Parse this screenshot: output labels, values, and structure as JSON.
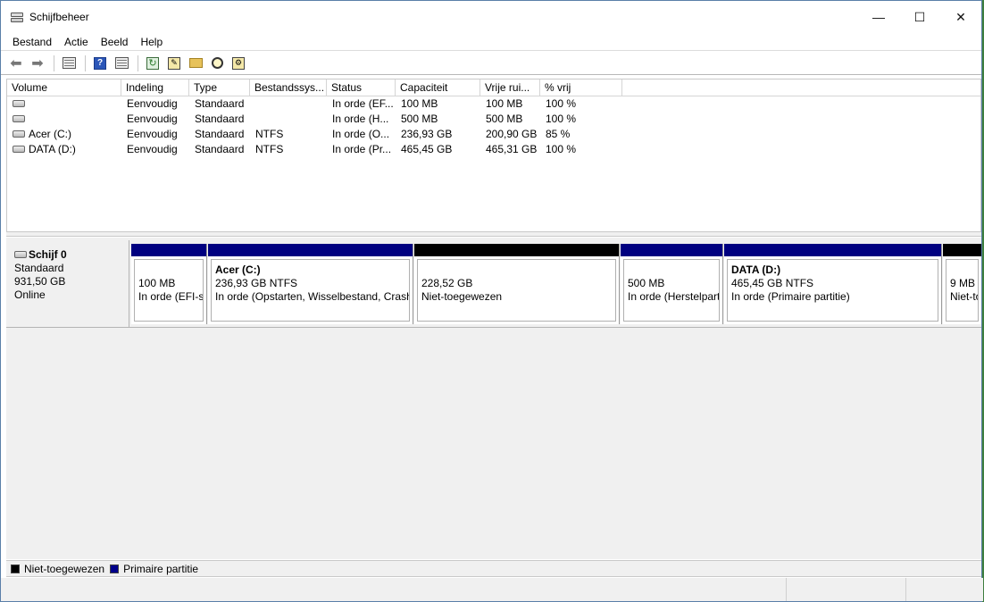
{
  "window": {
    "title": "Schijfbeheer",
    "controls": {
      "minimize": "—",
      "maximize": "☐",
      "close": "✕"
    }
  },
  "menu": [
    "Bestand",
    "Actie",
    "Beeld",
    "Help"
  ],
  "toolbar": {
    "icons": [
      "back-icon",
      "forward-icon",
      "console-tree-icon",
      "help-icon",
      "view-icon",
      "refresh-icon",
      "properties-icon",
      "open-folder-icon",
      "explore-icon",
      "settings-icon"
    ]
  },
  "volume_table": {
    "columns": [
      "Volume",
      "Indeling",
      "Type",
      "Bestandssys...",
      "Status",
      "Capaciteit",
      "Vrije rui...",
      "% vrij"
    ],
    "rows": [
      [
        "",
        "Eenvoudig",
        "Standaard",
        "",
        "In orde (EF...",
        "100 MB",
        "100 MB",
        "100 %"
      ],
      [
        "",
        "Eenvoudig",
        "Standaard",
        "",
        "In orde (H...",
        "500 MB",
        "500 MB",
        "100 %"
      ],
      [
        "Acer (C:)",
        "Eenvoudig",
        "Standaard",
        "NTFS",
        "In orde (O...",
        "236,93 GB",
        "200,90 GB",
        "85 %"
      ],
      [
        "DATA (D:)",
        "Eenvoudig",
        "Standaard",
        "NTFS",
        "In orde (Pr...",
        "465,45 GB",
        "465,31 GB",
        "100 %"
      ]
    ]
  },
  "disk": {
    "name": "Schijf 0",
    "type": "Standaard",
    "size": "931,50 GB",
    "state": "Online",
    "partitions": [
      {
        "name": "",
        "size": "100 MB",
        "status": "In orde (EFI-systeempartitie)",
        "kind": "primary"
      },
      {
        "name": "Acer  (C:)",
        "size": "236,93 GB NTFS",
        "status": "In orde (Opstarten, Wisselbestand, Crashdump, Primaire partitie)",
        "kind": "primary"
      },
      {
        "name": "",
        "size": "228,52 GB",
        "status": "Niet-toegewezen",
        "kind": "unallocated"
      },
      {
        "name": "",
        "size": "500 MB",
        "status": "In orde (Herstelpartitie)",
        "kind": "primary"
      },
      {
        "name": "DATA  (D:)",
        "size": "465,45 GB NTFS",
        "status": "In orde (Primaire partitie)",
        "kind": "primary"
      },
      {
        "name": "",
        "size": "9 MB",
        "status": "Niet-toegewezen",
        "kind": "unallocated"
      }
    ]
  },
  "legend": [
    {
      "label": "Niet-toegewezen",
      "color": "#000000"
    },
    {
      "label": "Primaire partitie",
      "color": "#00008b"
    }
  ],
  "colors": {
    "primary": "#000080",
    "unallocated": "#000000"
  }
}
